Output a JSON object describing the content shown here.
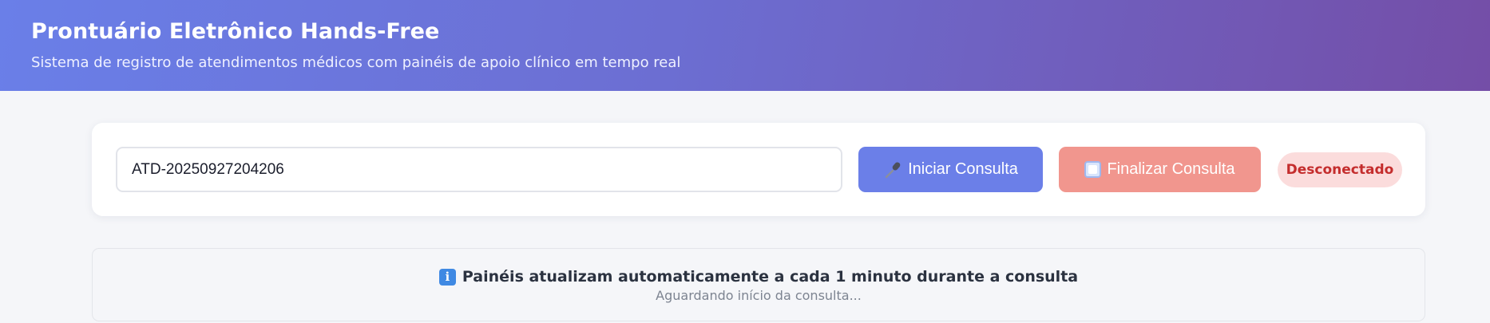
{
  "header": {
    "title": "Prontuário Eletrônico Hands-Free",
    "subtitle": "Sistema de registro de atendimentos médicos com painéis de apoio clínico em tempo real"
  },
  "controls": {
    "consultation_id_value": "ATD-20250927204206",
    "start_button": {
      "icon": "microphone-icon",
      "label": "Iniciar Consulta"
    },
    "stop_button": {
      "icon": "stop-icon",
      "label": "Finalizar Consulta"
    },
    "connection_status": "Desconectado"
  },
  "info_panel": {
    "icon": "info-icon",
    "message": "Painéis atualizam automaticamente a cada 1 minuto durante a consulta",
    "status": "Aguardando início da consulta..."
  },
  "colors": {
    "header_gradient_start": "#6a7fe8",
    "header_gradient_end": "#744ea7",
    "start_button": "#6b7fe8",
    "stop_button": "#f1968e",
    "status_badge_bg": "#fbdcdc",
    "status_badge_text": "#c42d2d"
  }
}
